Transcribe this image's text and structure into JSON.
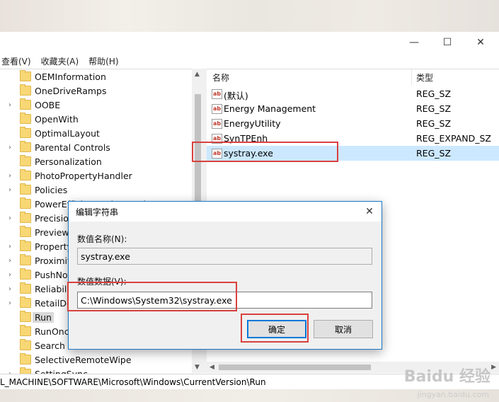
{
  "menu": [
    "查看(V)",
    "收藏夹(A)",
    "帮助(H)"
  ],
  "tree_items": [
    {
      "label": "OEMInformation",
      "expandable": false
    },
    {
      "label": "OneDriveRamps",
      "expandable": false
    },
    {
      "label": "OOBE",
      "expandable": true
    },
    {
      "label": "OpenWith",
      "expandable": false
    },
    {
      "label": "OptimalLayout",
      "expandable": false
    },
    {
      "label": "Parental Controls",
      "expandable": true
    },
    {
      "label": "Personalization",
      "expandable": false
    },
    {
      "label": "PhotoPropertyHandler",
      "expandable": true
    },
    {
      "label": "Policies",
      "expandable": true
    },
    {
      "label": "PowerEfficiencyDiagnostics",
      "expandable": false
    },
    {
      "label": "Precision",
      "expandable": true
    },
    {
      "label": "PreviewHandlers",
      "expandable": false
    },
    {
      "label": "PropertySystem",
      "expandable": true
    },
    {
      "label": "Proximity",
      "expandable": true
    },
    {
      "label": "PushNotifications",
      "expandable": true
    },
    {
      "label": "Reliability",
      "expandable": true
    },
    {
      "label": "RetailDemo",
      "expandable": true
    },
    {
      "label": "Run",
      "expandable": false,
      "selected": true
    },
    {
      "label": "RunOnce",
      "expandable": false
    },
    {
      "label": "Search",
      "expandable": false
    },
    {
      "label": "SelectiveRemoteWipe",
      "expandable": false
    },
    {
      "label": "SettingSync",
      "expandable": true
    }
  ],
  "list": {
    "headers": {
      "name": "名称",
      "type": "类型"
    },
    "rows": [
      {
        "name": "(默认)",
        "type": "REG_SZ"
      },
      {
        "name": "Energy Management",
        "type": "REG_SZ"
      },
      {
        "name": "EnergyUtility",
        "type": "REG_SZ"
      },
      {
        "name": "SynTPEnh",
        "type": "REG_EXPAND_SZ"
      },
      {
        "name": "systray.exe",
        "type": "REG_SZ",
        "selected": true
      }
    ]
  },
  "status": "L_MACHINE\\SOFTWARE\\Microsoft\\Windows\\CurrentVersion\\Run",
  "dialog": {
    "title": "编辑字符串",
    "name_label": "数值名称(N):",
    "name_value": "systray.exe",
    "data_label": "数值数据(V):",
    "data_value": "C:\\Windows\\System32\\systray.exe",
    "ok": "确定",
    "cancel": "取消"
  },
  "watermark": {
    "brand": "Baidu 经验",
    "url": "jingyan.baidu.com"
  },
  "icons": {
    "value_icon": "ab"
  },
  "colors": {
    "accent": "#0078d7",
    "highlight": "#d9413f",
    "selection": "#cce8ff"
  }
}
